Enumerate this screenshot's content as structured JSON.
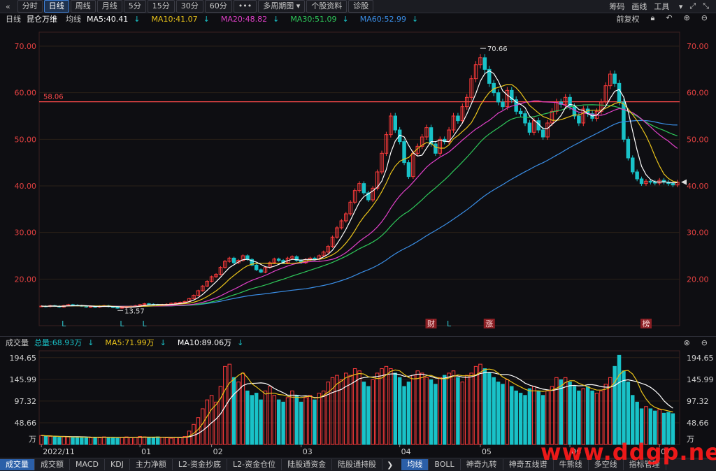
{
  "toolbar": {
    "back_glyph": "«",
    "periods": [
      "分时",
      "日线",
      "周线",
      "月线",
      "5分",
      "15分",
      "30分",
      "60分",
      "•••"
    ],
    "active_index": 1,
    "multi_period": "多周期图",
    "stock_info": "个股资料",
    "diagnose": "诊股",
    "right_items": [
      "筹码",
      "画线",
      "工具"
    ],
    "window_glyphs": [
      "⤢",
      "⤡"
    ]
  },
  "main_header": {
    "period": "日线",
    "stock_name": "昆仑万维",
    "ma_label": "均线",
    "ma5": "MA5:40.41",
    "ma10": "MA10:41.07",
    "ma20": "MA20:48.82",
    "ma30": "MA30:51.09",
    "ma60": "MA60:52.99",
    "adjust": "前复权",
    "icon_lock": "lock-icon",
    "icon_undo": "undo-icon",
    "icon_zoom_in": "zoom-in-icon",
    "icon_zoom_out": "zoom-out-icon"
  },
  "volume_header": {
    "label": "成交量",
    "total": "总量:68.93万",
    "ma5": "MA5:71.99万",
    "ma10": "MA10:89.06万"
  },
  "bottom_tabs_left": [
    "成交量",
    "成交额",
    "MACD",
    "KDJ",
    "主力净额",
    "L2-资金抄底",
    "L2-资金仓位",
    "陆股通资金",
    "陆股通持股"
  ],
  "bottom_tabs_right": [
    "均线",
    "BOLL",
    "神奇九转",
    "神奇五线谱",
    "牛熊线",
    "多空线",
    "指标管理"
  ],
  "bottom_active_left": 0,
  "bottom_active_right": 0,
  "watermark": "www.ddgp.net",
  "colors": {
    "up": "#ff3b3b",
    "down": "#19c2c8",
    "ma5": "#ffffff",
    "ma10": "#e8c21a",
    "ma20": "#e040c8",
    "ma30": "#2ec85a",
    "ma60": "#3a8ee6",
    "hline": "#ff4a4a",
    "grid": "#2a2018",
    "axis_text": "#e04040"
  },
  "chart_data": {
    "type": "candlestick",
    "price_axis": {
      "ylim": [
        10,
        73
      ],
      "ticks": [
        20,
        30,
        40,
        50,
        60,
        70
      ],
      "tick_labels": [
        "20.00",
        "30.00",
        "40.00",
        "50.00",
        "60.00",
        "70.00"
      ]
    },
    "horizontal_line": {
      "value": 58.06,
      "label": "58.06"
    },
    "annotations": {
      "high": "70.66",
      "low": "13.57"
    },
    "markers": [
      {
        "text": "L",
        "date_index": 5
      },
      {
        "text": "L",
        "date_index": 18
      },
      {
        "text": "L",
        "date_index": 23
      },
      {
        "text": "财",
        "date_index": 87,
        "boxed": true
      },
      {
        "text": "L",
        "date_index": 91
      },
      {
        "text": "涨",
        "date_index": 100,
        "boxed": true
      },
      {
        "text": "榜",
        "date_index": 135,
        "boxed": true
      }
    ],
    "x_labels": [
      {
        "text": "2022/11",
        "date_index": 0
      },
      {
        "text": "01",
        "date_index": 22
      },
      {
        "text": "02",
        "date_index": 38
      },
      {
        "text": "03",
        "date_index": 58
      },
      {
        "text": "04",
        "date_index": 80
      },
      {
        "text": "05",
        "date_index": 98
      },
      {
        "text": "06",
        "date_index": 118
      },
      {
        "text": "07",
        "date_index": 138
      }
    ],
    "closes": [
      14.2,
      14.1,
      14.3,
      14.2,
      14.0,
      14.3,
      14.5,
      14.4,
      14.3,
      14.2,
      14.0,
      14.1,
      14.0,
      14.2,
      14.3,
      14.1,
      13.9,
      13.8,
      13.9,
      14.0,
      14.2,
      14.3,
      14.5,
      14.7,
      14.6,
      14.5,
      14.4,
      14.5,
      14.6,
      14.8,
      14.9,
      15.0,
      15.2,
      15.8,
      16.5,
      17.5,
      18.5,
      19.5,
      20.5,
      21.0,
      22.5,
      23.8,
      24.5,
      23.5,
      24.0,
      25.0,
      24.2,
      23.0,
      22.0,
      21.5,
      22.5,
      23.5,
      24.3,
      24.0,
      23.5,
      24.5,
      24.8,
      24.0,
      23.5,
      24.2,
      24.5,
      24.3,
      25.0,
      25.8,
      27.0,
      29.0,
      31.0,
      32.5,
      34.0,
      36.5,
      39.0,
      40.5,
      38.5,
      37.0,
      39.5,
      43.0,
      47.0,
      51.0,
      55.0,
      52.0,
      49.5,
      45.0,
      42.0,
      47.0,
      48.5,
      50.5,
      52.5,
      49.0,
      47.0,
      50.0,
      49.5,
      52.0,
      55.0,
      54.0,
      57.0,
      59.0,
      63.0,
      66.0,
      67.5,
      65.0,
      62.0,
      60.0,
      58.0,
      57.0,
      60.5,
      58.5,
      56.0,
      55.5,
      53.5,
      51.5,
      54.0,
      52.0,
      50.5,
      53.5,
      56.0,
      58.0,
      57.5,
      59.0,
      57.0,
      55.0,
      53.5,
      56.5,
      55.5,
      54.5,
      56.0,
      58.0,
      61.5,
      64.0,
      62.0,
      58.0,
      50.0,
      46.0,
      43.0,
      41.5,
      40.5,
      41.0,
      40.8,
      40.6,
      41.2,
      40.8,
      40.5,
      40.2,
      40.8
    ],
    "volume_axis": {
      "ticks": [
        48.66,
        97.32,
        145.99,
        194.65
      ],
      "tick_labels": [
        "48.66",
        "97.32",
        "145.99",
        "194.65"
      ],
      "unit": "万"
    },
    "volumes": [
      20,
      19,
      18,
      17,
      16,
      18,
      17,
      16,
      15,
      17,
      16,
      15,
      16,
      15,
      17,
      16,
      15,
      14,
      16,
      17,
      15,
      16,
      18,
      17,
      16,
      15,
      17,
      16,
      15,
      14,
      16,
      15,
      18,
      30,
      45,
      60,
      80,
      100,
      110,
      95,
      130,
      175,
      180,
      150,
      140,
      160,
      120,
      110,
      115,
      100,
      120,
      130,
      110,
      100,
      95,
      105,
      120,
      110,
      95,
      105,
      110,
      100,
      115,
      120,
      140,
      150,
      155,
      145,
      160,
      155,
      170,
      165,
      140,
      130,
      145,
      160,
      170,
      175,
      170,
      160,
      150,
      130,
      140,
      155,
      165,
      160,
      150,
      145,
      135,
      150,
      155,
      160,
      165,
      150,
      140,
      155,
      160,
      175,
      180,
      170,
      160,
      150,
      140,
      135,
      145,
      130,
      120,
      115,
      110,
      125,
      130,
      120,
      110,
      120,
      130,
      150,
      145,
      150,
      140,
      130,
      120,
      125,
      130,
      120,
      115,
      120,
      135,
      150,
      175,
      200,
      165,
      140,
      110,
      95,
      80,
      85,
      80,
      75,
      78,
      70,
      72,
      69
    ]
  }
}
